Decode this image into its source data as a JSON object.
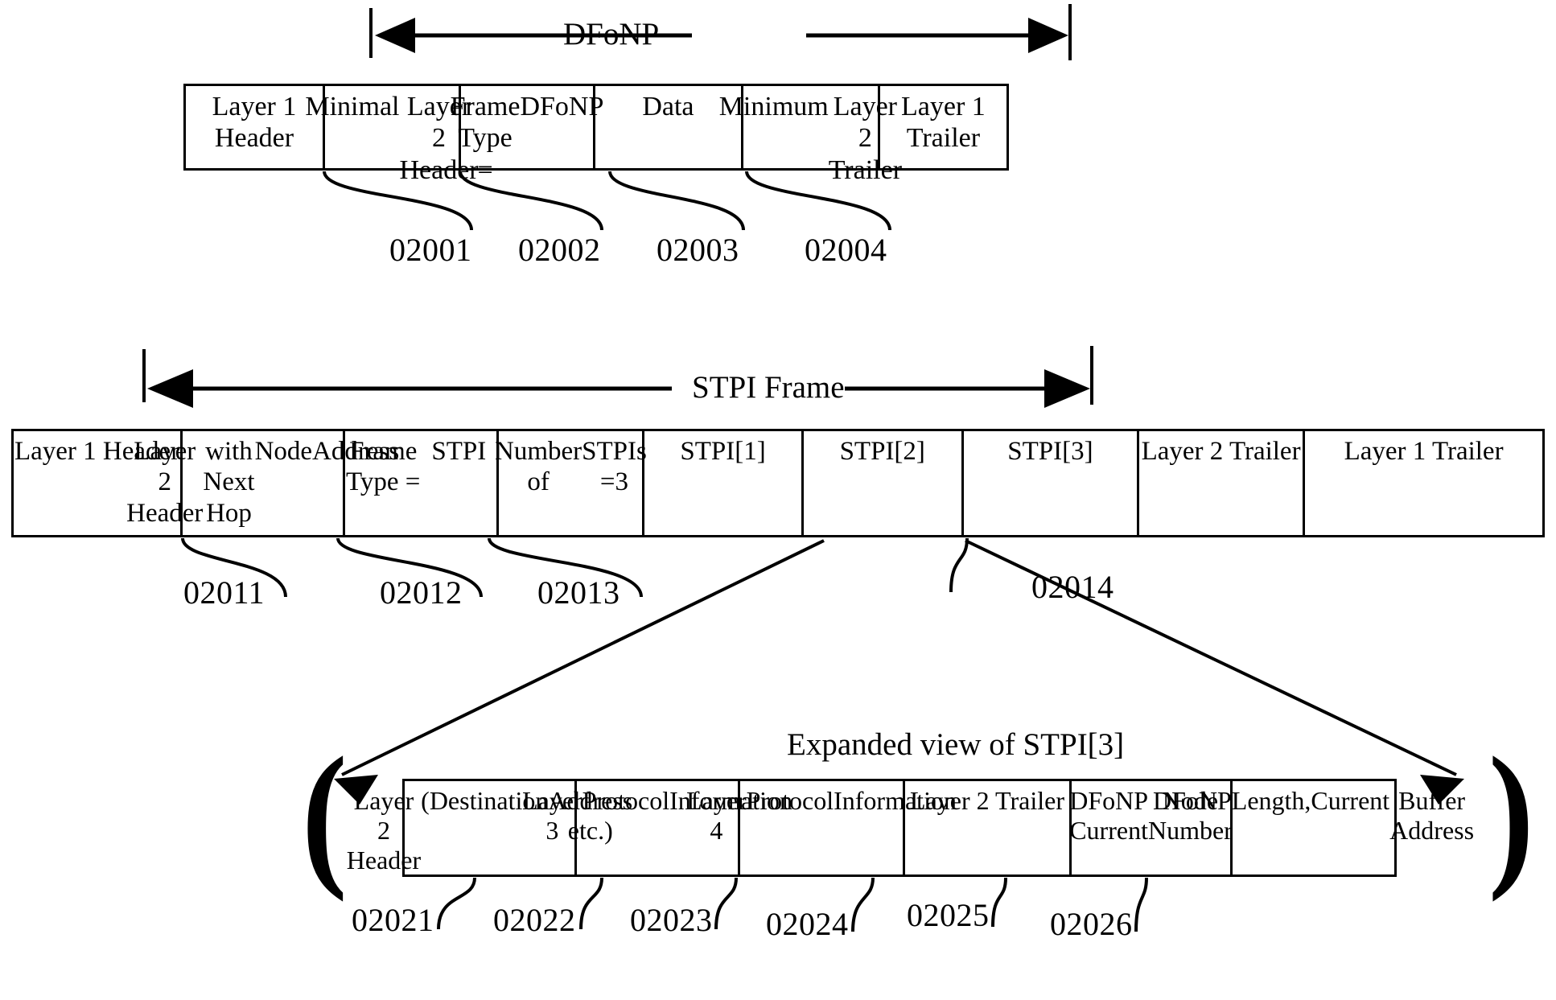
{
  "figure": {
    "type": "protocol-frame-format-diagram",
    "ink_color": "#000000",
    "background": "#ffffff"
  },
  "dfonp_section": {
    "span_label": "DFoNP",
    "fields": [
      {
        "label": "Layer 1 Header",
        "lines": [
          "Layer 1 Header"
        ]
      },
      {
        "label": "Minimal Layer 2 Header",
        "lines": [
          "Minimal",
          "Layer 2 Header"
        ]
      },
      {
        "label": "Frame Type = DFoNP",
        "lines": [
          "Frame Type =",
          "DFoNP"
        ]
      },
      {
        "label": "Data",
        "lines": [
          "Data"
        ]
      },
      {
        "label": "Minimum Layer 2 Trailer",
        "lines": [
          "Minimum",
          "Layer 2 Trailer"
        ]
      },
      {
        "label": "Layer 1 Trailer",
        "lines": [
          "Layer 1 Trailer"
        ]
      }
    ],
    "ref_numbers": [
      "02001",
      "02002",
      "02003",
      "02004"
    ]
  },
  "stpi_section": {
    "span_label": "STPI Frame",
    "fields": [
      {
        "label": "Layer 1 Header",
        "lines": [
          "Layer 1 Header"
        ]
      },
      {
        "label": "Layer 2 Header with Next Hop NodeAddress",
        "lines": [
          "Layer 2 Header",
          "with Next Hop",
          "NodeAddress"
        ]
      },
      {
        "label": "Frame Type = STPI",
        "lines": [
          "Frame Type =",
          "STPI"
        ]
      },
      {
        "label": "Number of STPIs =3",
        "lines": [
          "Number of",
          "STPIs =3"
        ]
      },
      {
        "label": "STPI[1]",
        "lines": [
          "STPI[1]"
        ]
      },
      {
        "label": "STPI[2]",
        "lines": [
          "STPI[2]"
        ]
      },
      {
        "label": "STPI[3]",
        "lines": [
          "STPI[3]"
        ]
      },
      {
        "label": "Layer 2 Trailer",
        "lines": [
          "Layer 2 Trailer"
        ]
      },
      {
        "label": "Layer 1 Trailer",
        "lines": [
          "Layer 1 Trailer"
        ]
      }
    ],
    "ref_numbers": [
      "02011",
      "02012",
      "02013",
      "02014"
    ]
  },
  "expanded_section": {
    "title": "Expanded view of STPI[3]",
    "fields": [
      {
        "label": "Layer 2 Header (Destination Address etc.)",
        "lines": [
          "Layer 2 Header",
          "(Destination",
          "Address etc.)"
        ]
      },
      {
        "label": "Layer 3 Protocol Information",
        "lines": [
          "Layer 3",
          "Protocol",
          "Information"
        ]
      },
      {
        "label": "Layer 4 Protocol Information",
        "lines": [
          "Layer 4",
          "Protocol",
          "Information"
        ]
      },
      {
        "label": "Layer 2 Trailer",
        "lines": [
          "Layer 2 Trailer"
        ]
      },
      {
        "label": "DFoNP Current Node Number",
        "lines": [
          "DFoNP Current",
          "Node Number"
        ]
      },
      {
        "label": "DFoNP Length,Current Buffer Address",
        "lines": [
          "DFoNP",
          "Length,Current",
          "Buffer Address"
        ]
      }
    ],
    "ref_numbers": [
      "02021",
      "02022",
      "02023",
      "02024",
      "02025",
      "02026"
    ],
    "bracket_left": "(",
    "bracket_right": ")"
  }
}
